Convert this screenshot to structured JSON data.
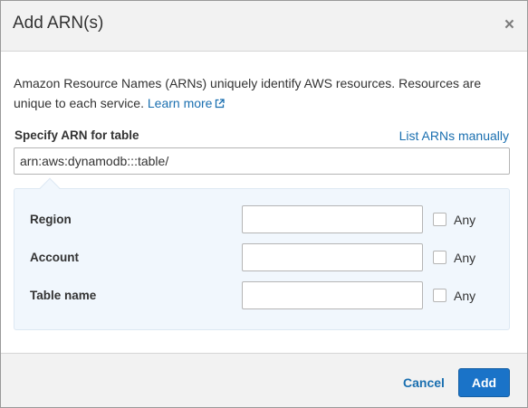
{
  "dialog": {
    "title": "Add ARN(s)",
    "close_icon": "close-icon"
  },
  "description": {
    "text": "Amazon Resource Names (ARNs) uniquely identify AWS resources. Resources are unique to each service.",
    "learn_more": "Learn more",
    "learn_more_icon": "external-link-icon"
  },
  "specify": {
    "label": "Specify ARN for table",
    "list_manually": "List ARNs manually",
    "arn_value": "arn:aws:dynamodb:::table/"
  },
  "fields": [
    {
      "label": "Region",
      "value": "",
      "any_label": "Any",
      "any_checked": false
    },
    {
      "label": "Account",
      "value": "",
      "any_label": "Any",
      "any_checked": false
    },
    {
      "label": "Table name",
      "value": "",
      "any_label": "Any",
      "any_checked": false
    }
  ],
  "footer": {
    "cancel": "Cancel",
    "add": "Add"
  },
  "colors": {
    "link": "#1a6fb0",
    "primary_button": "#1a73c8",
    "panel_background": "#f1f7fd",
    "header_background": "#f2f2f2"
  }
}
